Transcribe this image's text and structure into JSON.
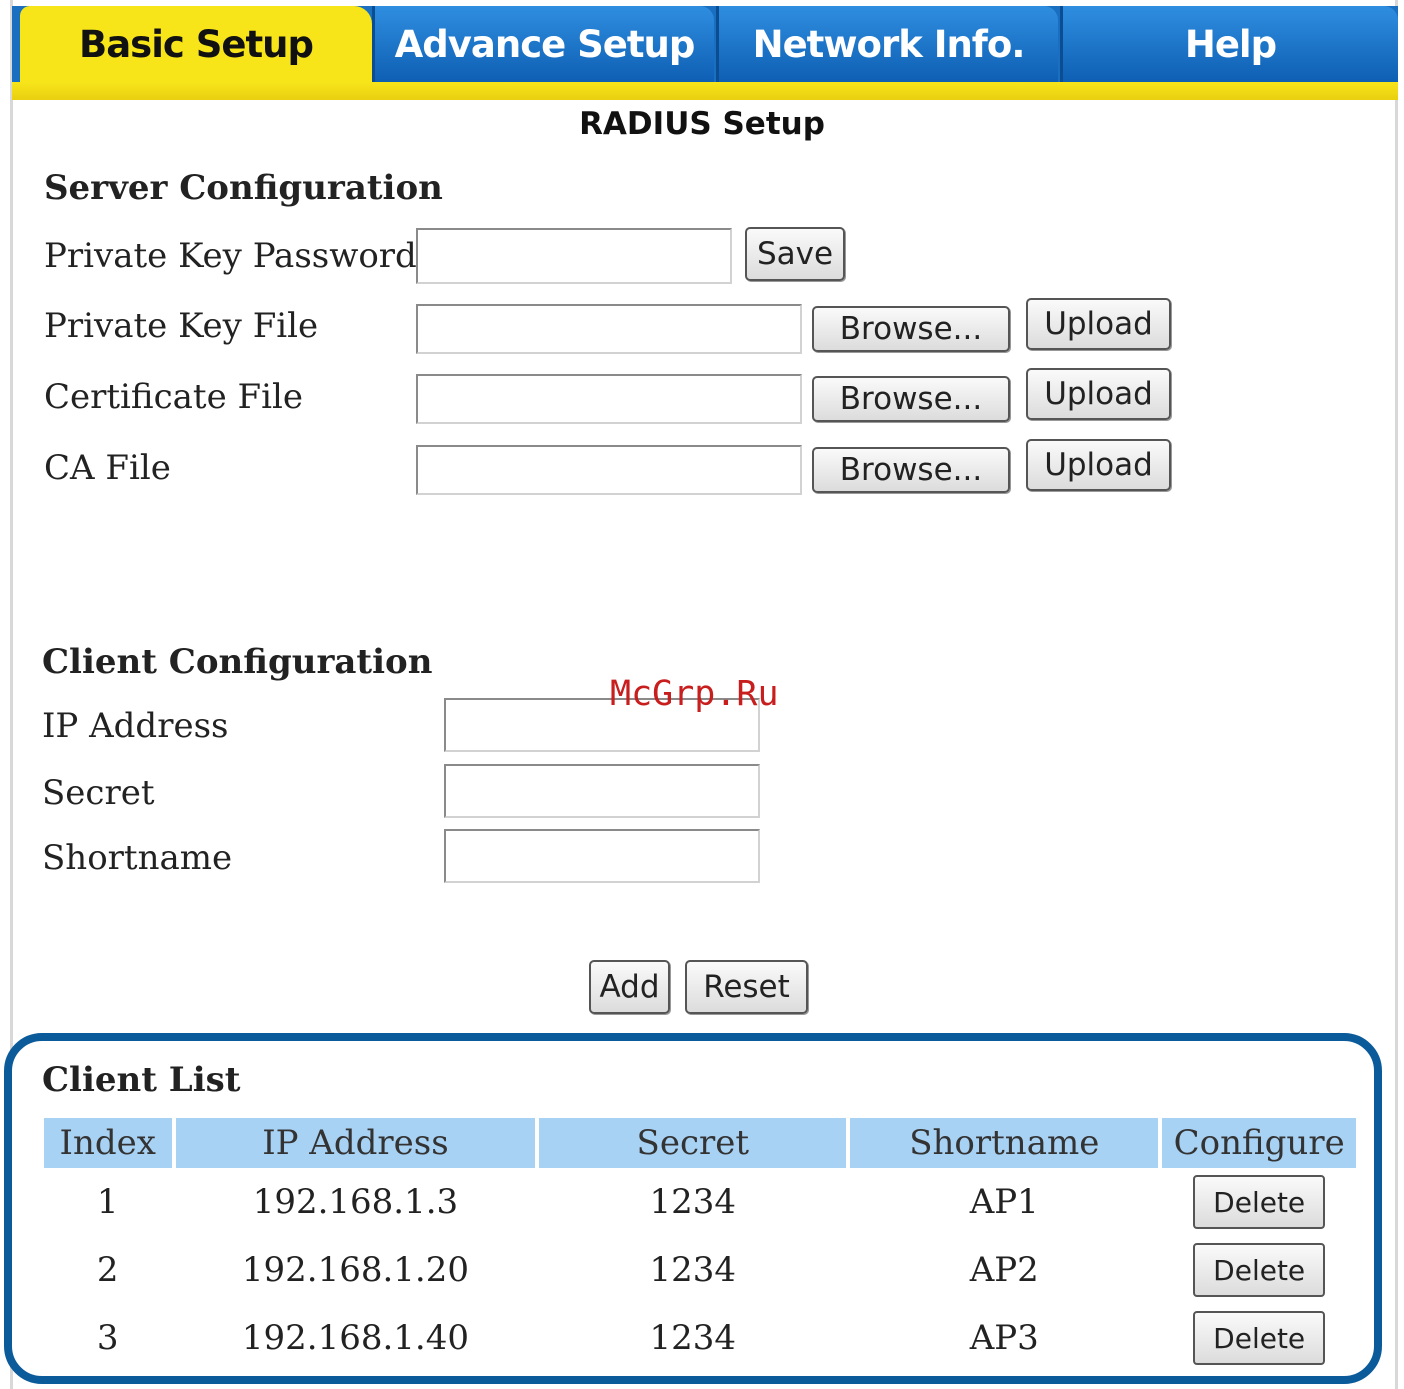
{
  "tabs": [
    {
      "label": "Basic Setup",
      "active": true
    },
    {
      "label": "Advance Setup",
      "active": false
    },
    {
      "label": "Network Info.",
      "active": false
    },
    {
      "label": "Help",
      "active": false
    }
  ],
  "page_title": "RADIUS Setup",
  "server_config": {
    "title": "Server Configuration",
    "private_key_password_label": "Private Key Password",
    "private_key_password_value": "",
    "save_label": "Save",
    "private_key_file_label": "Private Key File",
    "certificate_file_label": "Certificate File",
    "ca_file_label": "CA File",
    "browse_label": "Browse...",
    "upload_label": "Upload"
  },
  "client_config": {
    "title": "Client Configuration",
    "ip_label": "IP Address",
    "secret_label": "Secret",
    "shortname_label": "Shortname",
    "add_label": "Add",
    "reset_label": "Reset"
  },
  "watermark": "McGrp.Ru",
  "client_list": {
    "title": "Client List",
    "columns": [
      "Index",
      "IP Address",
      "Secret",
      "Shortname",
      "Configure"
    ],
    "rows": [
      {
        "index": "1",
        "ip": "192.168.1.3",
        "secret": "1234",
        "shortname": "AP1",
        "action": "Delete"
      },
      {
        "index": "2",
        "ip": "192.168.1.20",
        "secret": "1234",
        "shortname": "AP2",
        "action": "Delete"
      },
      {
        "index": "3",
        "ip": "192.168.1.40",
        "secret": "1234",
        "shortname": "AP3",
        "action": "Delete"
      }
    ]
  },
  "colors": {
    "tab_blue": "#1a6fc0",
    "tab_yellow": "#f7e51a",
    "header_cell": "#a8d2f4",
    "highlight_border": "#0b5b9a",
    "watermark": "#c81e1e"
  }
}
